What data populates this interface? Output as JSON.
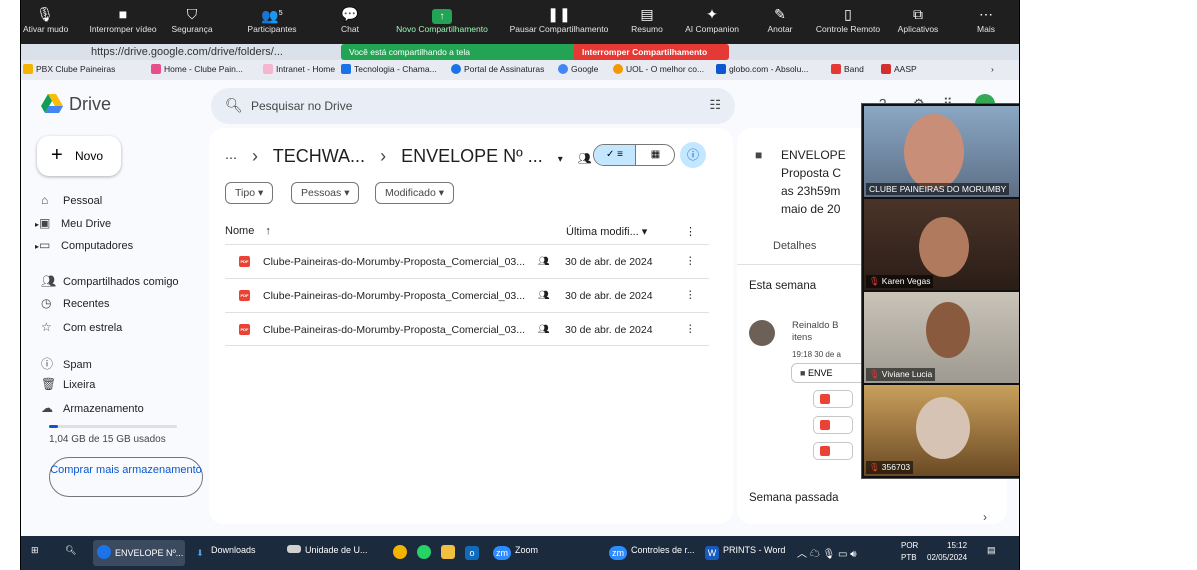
{
  "zoom_toolbar": {
    "items": [
      {
        "label": "Ativar mudo",
        "icon": "microphone-icon"
      },
      {
        "label": "Interromper vídeo",
        "icon": "video-icon"
      },
      {
        "label": "Segurança",
        "icon": "shield-icon"
      },
      {
        "label": "Participantes",
        "icon": "participants-icon",
        "count": "5"
      },
      {
        "label": "Chat",
        "icon": "chat-icon"
      },
      {
        "label": "Novo Compartilhamento",
        "icon": "share-arrow-icon"
      },
      {
        "label": "Pausar Compartilhamento",
        "icon": "pause-icon"
      },
      {
        "label": "Resumo",
        "icon": "summary-icon"
      },
      {
        "label": "AI Companion",
        "icon": "sparkle-icon"
      },
      {
        "label": "Anotar",
        "icon": "pen-icon"
      },
      {
        "label": "Controle Remoto",
        "icon": "mouse-icon"
      },
      {
        "label": "Aplicativos",
        "icon": "apps-icon"
      },
      {
        "label": "Mais",
        "icon": "more-icon"
      }
    ],
    "sharing_notice": "Você está compartilhando a tela",
    "stop_sharing": "Interromper Compartilhamento"
  },
  "browser": {
    "url_fragment": "https://drive.google.com/drive/folders/...",
    "bookmarks": [
      "PBX Clube Paineiras",
      "Home - Clube Pain...",
      "Intranet - Home",
      "Tecnologia - Chama...",
      "Portal de Assinaturas",
      "Google",
      "UOL - O melhor co...",
      "globo.com - Absolu...",
      "Band",
      "AASP"
    ]
  },
  "drive": {
    "app_name": "Drive",
    "search_placeholder": "Pesquisar no Drive",
    "new_button": "Novo",
    "nav": [
      {
        "label": "Pessoal",
        "icon": "home-icon"
      },
      {
        "label": "Meu Drive",
        "icon": "my-drive-icon"
      },
      {
        "label": "Computadores",
        "icon": "computer-icon"
      },
      {
        "label": "Compartilhados comigo",
        "icon": "shared-icon"
      },
      {
        "label": "Recentes",
        "icon": "clock-icon"
      },
      {
        "label": "Com estrela",
        "icon": "star-icon"
      },
      {
        "label": "Spam",
        "icon": "spam-icon"
      },
      {
        "label": "Lixeira",
        "icon": "trash-icon"
      },
      {
        "label": "Armazenamento",
        "icon": "cloud-icon"
      }
    ],
    "storage_text": "1,04 GB de 15 GB usados",
    "storage_used_fraction": 0.07,
    "buy_storage": "Comprar mais armazenamento",
    "breadcrumb": [
      "TECHWA...",
      "ENVELOPE Nº ..."
    ],
    "filters": [
      "Tipo",
      "Pessoas",
      "Modificado"
    ],
    "columns": {
      "name": "Nome",
      "modified": "Última modifi..."
    },
    "files": [
      {
        "name": "Clube-Paineiras-do-Morumby-Proposta_Comercial_03...",
        "modified": "30 de abr. de 2024"
      },
      {
        "name": "Clube-Paineiras-do-Morumby-Proposta_Comercial_03...",
        "modified": "30 de abr. de 2024"
      },
      {
        "name": "Clube-Paineiras-do-Morumby-Proposta_Comercial_03...",
        "modified": "30 de abr. de 2024"
      }
    ],
    "details": {
      "title_lines": [
        "ENVELOPE",
        "Proposta C",
        "as 23h59m",
        "maio de 20"
      ],
      "tab": "Detalhes",
      "this_week": "Esta semana",
      "activity_user": "Reinaldo B",
      "activity_suffix": "itens",
      "activity_time": "19:18 30 de a",
      "activity_folder": "ENVE",
      "last_week": "Semana passada"
    }
  },
  "participants": [
    {
      "name": "CLUBE PAINEIRAS DO MORUMBY",
      "muted": false
    },
    {
      "name": "Karen Vegas",
      "muted": true
    },
    {
      "name": "Viviane Lucia",
      "muted": true
    },
    {
      "name": "356703",
      "muted": true
    }
  ],
  "taskbar": {
    "items": [
      "ENVELOPE Nº...",
      "Downloads",
      "Unidade de U...",
      "Zoom",
      "Controles de r...",
      "PRINTS - Word"
    ],
    "language": "POR",
    "layout": "PTB",
    "time": "15:12",
    "date": "02/05/2024"
  }
}
